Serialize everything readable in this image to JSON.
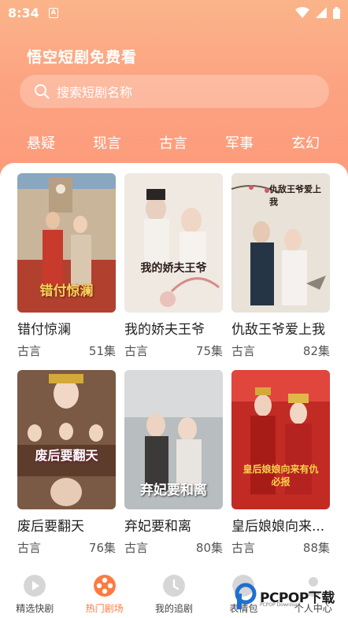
{
  "status": {
    "time": "8:34",
    "a_badge": "A"
  },
  "app": {
    "title": "悟空短剧免费看"
  },
  "search": {
    "placeholder": "搜索短剧名称"
  },
  "categories": [
    "悬疑",
    "现言",
    "古言",
    "军事",
    "玄幻"
  ],
  "dramas": [
    {
      "title": "错付惊澜",
      "genre": "古言",
      "episodes": "51集",
      "poster_text": "错付惊澜",
      "poster_color": "#b2402f"
    },
    {
      "title": "我的娇夫王爷",
      "genre": "古言",
      "episodes": "75集",
      "poster_text": "我的娇夫王爷",
      "poster_color": "#e6dcd2"
    },
    {
      "title": "仇敌王爷爱上我",
      "genre": "古言",
      "episodes": "82集",
      "poster_text": "仇敌王爷爱上我",
      "poster_color": "#dcd6cc"
    },
    {
      "title": "废后要翻天",
      "genre": "古言",
      "episodes": "76集",
      "poster_text": "废后要翻天",
      "poster_color": "#6b4a36"
    },
    {
      "title": "弃妃要和离",
      "genre": "古言",
      "episodes": "80集",
      "poster_text": "弃妃要和离",
      "poster_color": "#9aa1a4"
    },
    {
      "title": "皇后娘娘向来...",
      "genre": "古言",
      "episodes": "88集",
      "poster_text": "皇后娘娘向来有仇必报",
      "poster_color": "#b8201c"
    }
  ],
  "nav": [
    {
      "label": "精选快剧",
      "icon": "play-icon",
      "active": false
    },
    {
      "label": "热门剧场",
      "icon": "film-reel-icon",
      "active": true
    },
    {
      "label": "我的追剧",
      "icon": "clock-icon",
      "active": false
    },
    {
      "label": "表情包",
      "icon": "emoji-icon",
      "active": false
    },
    {
      "label": "个人中心",
      "icon": "user-icon",
      "active": false
    }
  ],
  "watermark": {
    "text": "PCPOP下载",
    "sub": "PCPOP Download"
  },
  "colors": {
    "accent": "#ff7a42",
    "header_top": "#fbb48a",
    "header_bottom": "#fd9a7a"
  }
}
